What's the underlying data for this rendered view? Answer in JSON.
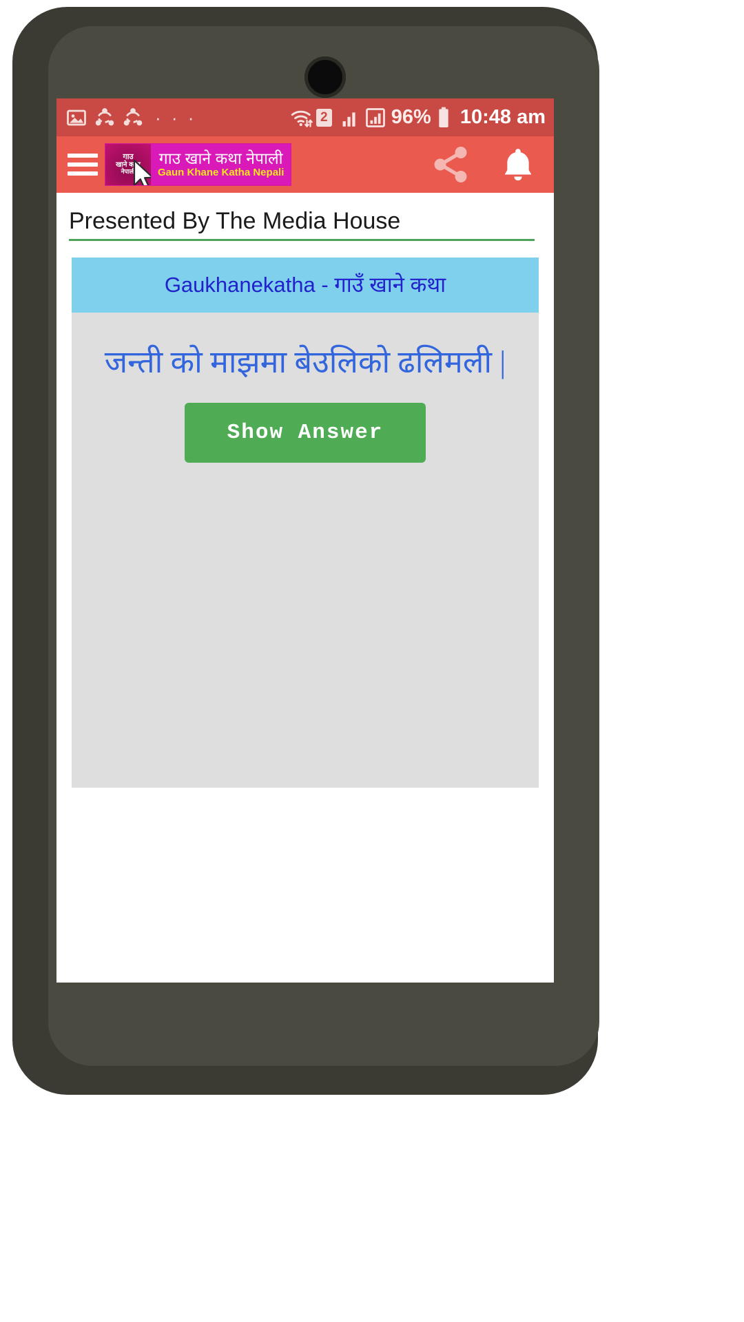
{
  "status_bar": {
    "left_icons": [
      "image-icon",
      "share-nodes-icon",
      "share-nodes-icon",
      "overflow-dots-icon"
    ],
    "overflow_dots": "· · ·",
    "wifi_icon": "wifi-transfer-icon",
    "sim_badge": "2",
    "signal_icon_1": "signal-bars-icon",
    "signal_icon_2": "signal-bars-boxed-icon",
    "battery_percent": "96%",
    "battery_icon": "battery-icon",
    "time": "10:48 am",
    "background_color": "#c94a44"
  },
  "app_bar": {
    "menu_icon": "hamburger-menu-icon",
    "logo": {
      "badge_line1": "गाउ",
      "badge_line2": "खाने कथा",
      "badge_line3": "नेपाली",
      "title_nepali": "गाउ खाने कथा नेपाली",
      "title_english": "Gaun Khane Katha Nepali"
    },
    "share_icon": "share-icon",
    "notification_icon": "bell-icon",
    "background_color": "#ea5a4f"
  },
  "content": {
    "presenter": "Presented By The Media House",
    "card": {
      "header": "Gaukhanekatha - गाउँ खाने कथा",
      "header_color": "#7fd0ec",
      "question": "जन्ती को माझमा बेउलिको ढलिमली |",
      "question_color": "#3366dd",
      "show_answer_label": "Show Answer",
      "show_answer_color": "#50ab55",
      "body_color": "#dedede"
    }
  }
}
